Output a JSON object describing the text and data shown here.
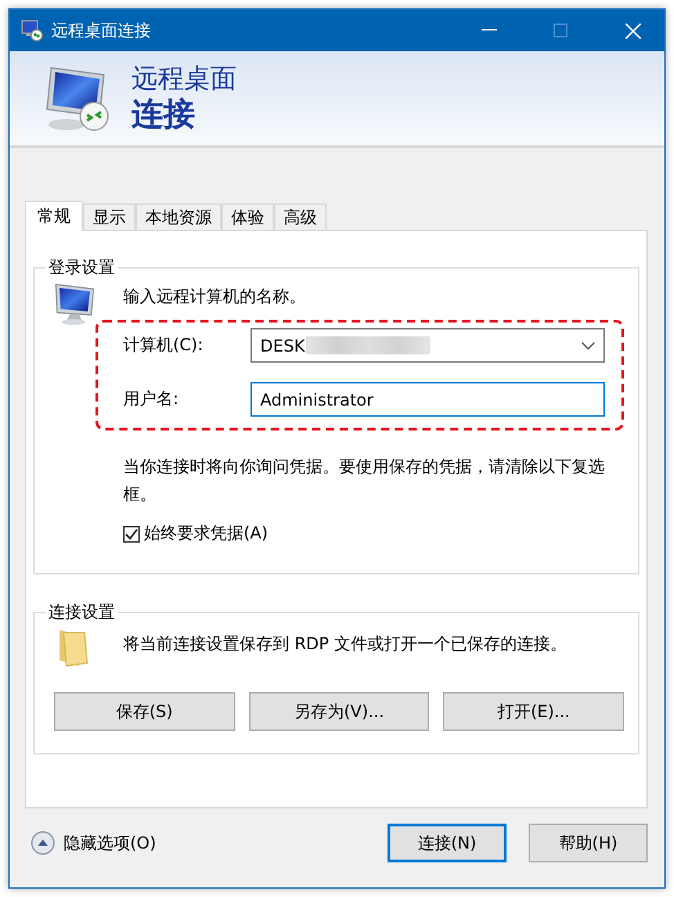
{
  "window": {
    "title": "远程桌面连接"
  },
  "header": {
    "line1": "远程桌面",
    "line2": "连接"
  },
  "tabs": [
    {
      "label": "常规",
      "selected": true
    },
    {
      "label": "显示",
      "selected": false
    },
    {
      "label": "本地资源",
      "selected": false
    },
    {
      "label": "体验",
      "selected": false
    },
    {
      "label": "高级",
      "selected": false
    }
  ],
  "login_settings": {
    "title": "登录设置",
    "prompt": "输入远程计算机的名称。",
    "computer": {
      "label": "计算机(C):",
      "value": "DESK"
    },
    "username": {
      "label": "用户名:",
      "value": "Administrator"
    },
    "note": "当你连接时将向你询问凭据。要使用保存的凭据，请清除以下复选框。",
    "always_ask": {
      "label": "始终要求凭据(A)",
      "checked": true
    }
  },
  "connection_settings": {
    "title": "连接设置",
    "description": "将当前连接设置保存到 RDP 文件或打开一个已保存的连接。",
    "buttons": [
      "保存(S)",
      "另存为(V)...",
      "打开(E)..."
    ]
  },
  "footer": {
    "toggle": "隐藏选项(O)",
    "buttons": [
      {
        "label": "连接(N)",
        "default": true
      },
      {
        "label": "帮助(H)",
        "default": false
      }
    ]
  }
}
